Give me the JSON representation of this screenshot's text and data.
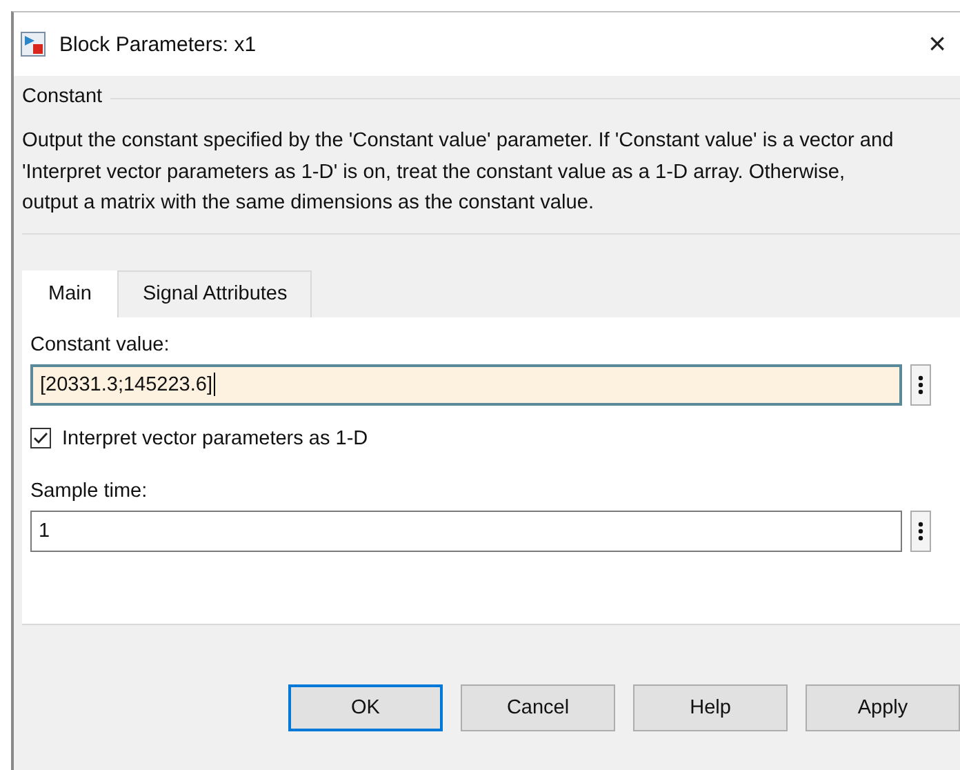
{
  "window": {
    "title": "Block Parameters: x1",
    "close": "×"
  },
  "group": {
    "title": "Constant",
    "description": "Output the constant specified by the 'Constant value' parameter. If 'Constant value' is a vector and 'Interpret vector parameters as 1-D' is on, treat the constant value as a 1-D array. Otherwise, output a matrix with the same dimensions as the constant value."
  },
  "tabs": [
    {
      "label": "Main",
      "selected": true
    },
    {
      "label": "Signal Attributes",
      "selected": false
    }
  ],
  "params": [
    {
      "kind": "field",
      "label": "Constant value:",
      "value": "[20331.3;145223.6]",
      "focused": true
    },
    {
      "kind": "checkbox",
      "label": "Interpret vector parameters as 1-D",
      "checked": true
    },
    {
      "kind": "field",
      "label": "Sample time:",
      "value": "1",
      "focused": false
    }
  ],
  "buttons": [
    {
      "label": "OK",
      "default": true
    },
    {
      "label": "Cancel",
      "default": false
    },
    {
      "label": "Help",
      "default": false
    },
    {
      "label": "Apply",
      "default": false
    }
  ]
}
